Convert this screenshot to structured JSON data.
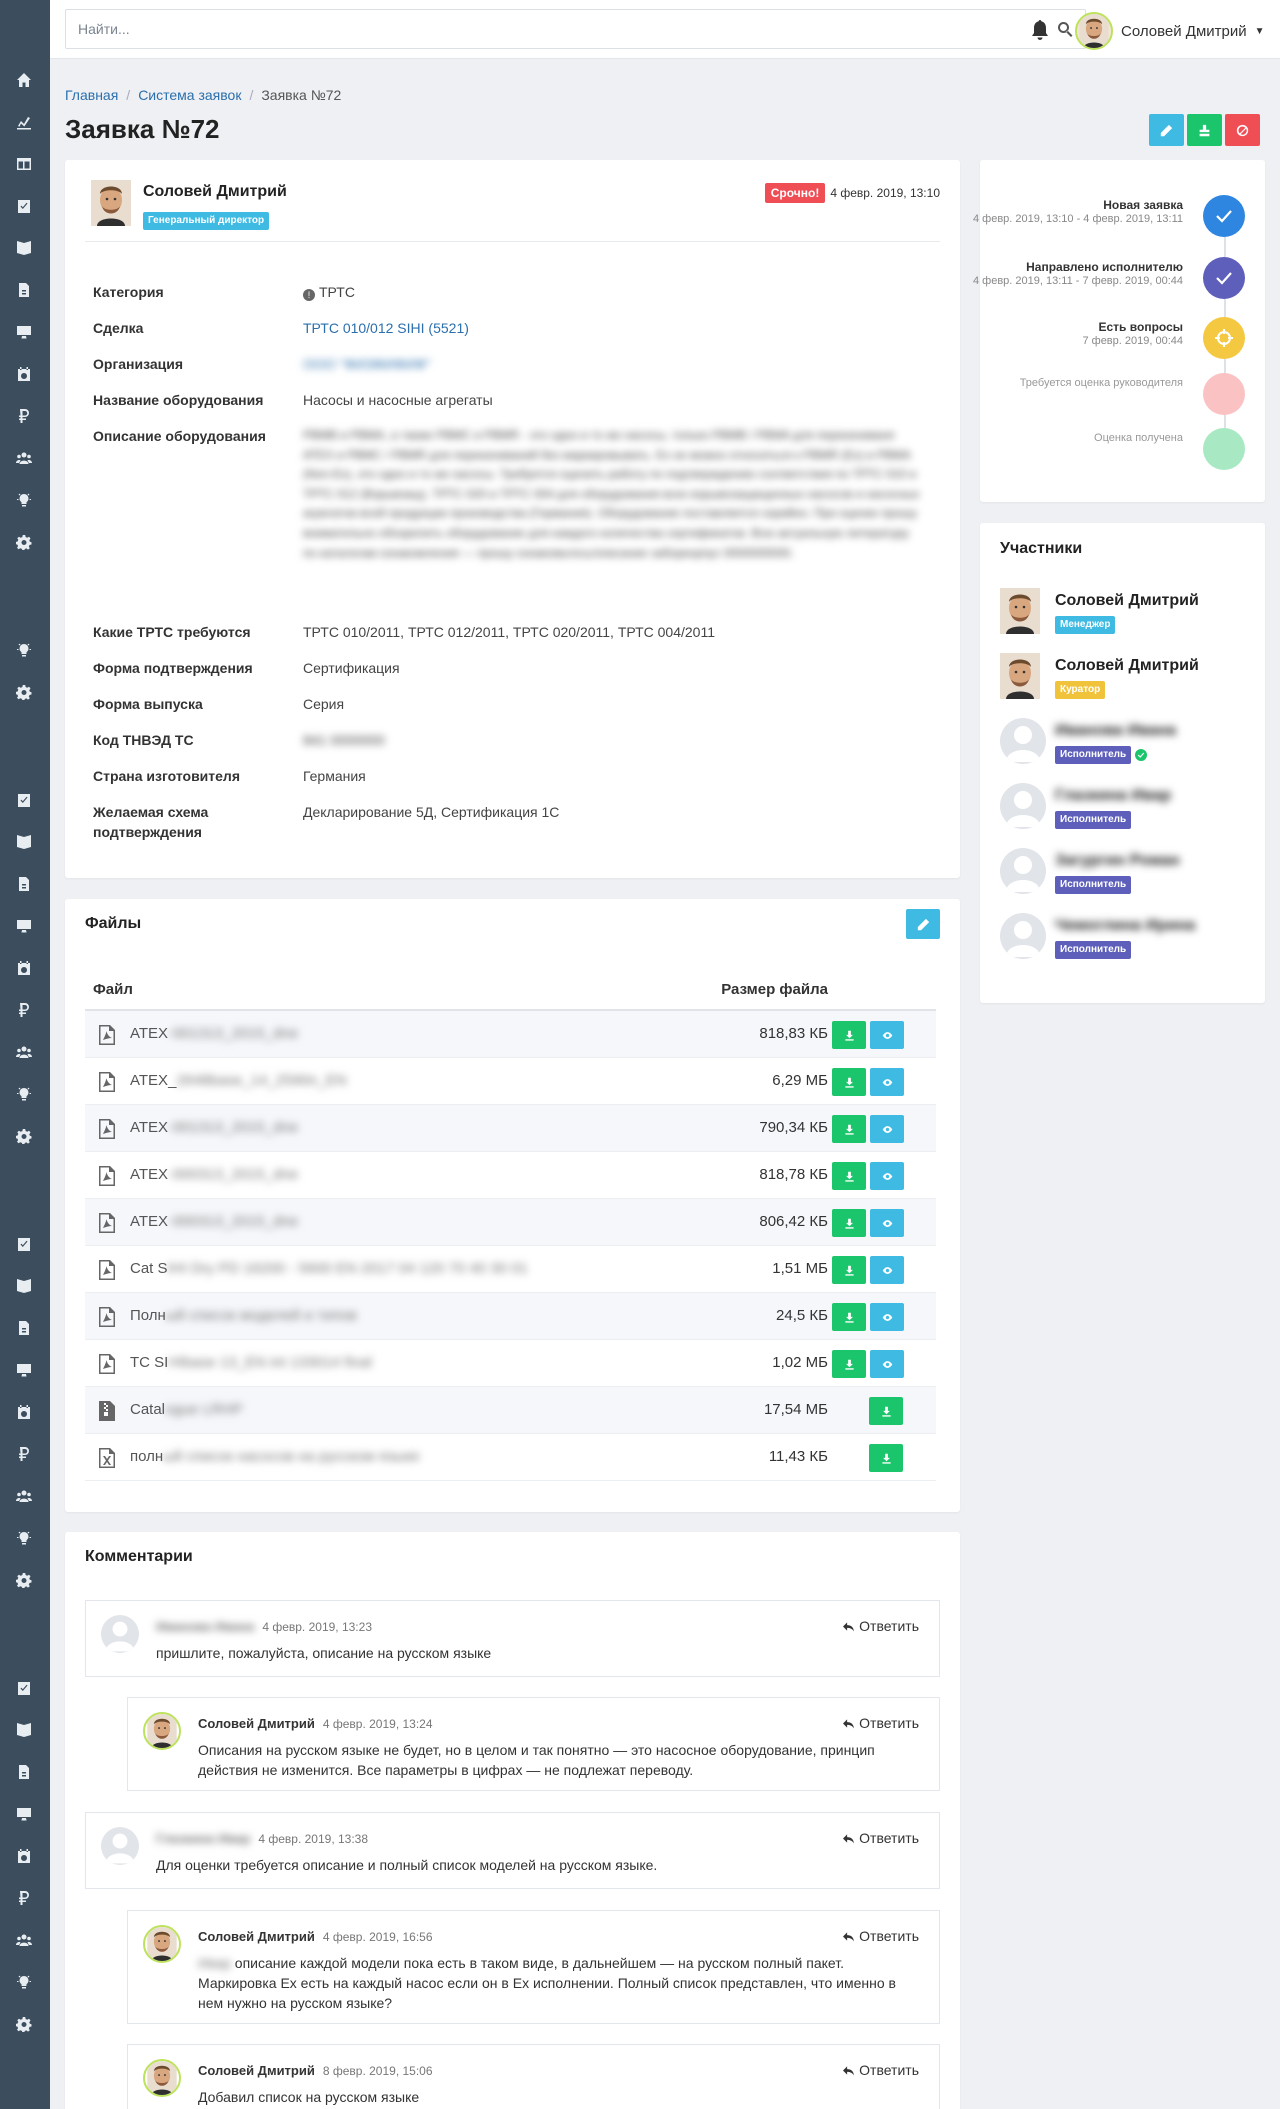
{
  "colors": {
    "sidebar": "#3c4e5e",
    "accent_blue": "#3ebae3",
    "green": "#1bc56b",
    "red": "#f04e55",
    "indigo": "#5d5fbb",
    "link": "#2b6fad"
  },
  "header": {
    "search_placeholder": "Найти...",
    "user_name": "Соловей Дмитрий"
  },
  "breadcrumb": [
    "Главная",
    "Система заявок",
    "Заявка №72"
  ],
  "page_title": "Заявка №72",
  "request": {
    "author": "Соловей Дмитрий",
    "role": "Генеральный директор",
    "priority": "Срочно!",
    "date": "4 февр. 2019, 13:10",
    "fields": [
      {
        "label": "Категория",
        "value": "ТРТС"
      },
      {
        "label": "Сделка",
        "value": "ТРТС 010/012 SIHI (5521)"
      },
      {
        "label": "Организация",
        "value": "ООО \"ФИЗФИФИФ\""
      },
      {
        "label": "Название оборудования",
        "value": "Насосы и насосные агрегаты"
      },
      {
        "label": "Описание оборудования",
        "value": "PBMB и PBMA, а также PBMC и PBMR - это одно и то же насосы, только PBMB / PBMA для перекачиваня ATEX и PBMC / PBMR для перекачиваний без маркировывать. Ex не можно относиться к PBMR (Ex) и PBMA (Non-Ex), это одно и то же насосы. Требуется оценить работу по подтверждению соответствия по ТРТС 010 и ТРТС 012 (Взрывзащ). ТРТС 020 и ТРТС 004 для оборудования всех взрывозащищенных насосов и насосных агрегатов всей продукции производства (Германия). Оборудование поставляется серийно. При оценке прошу внимательно обозрелить оборудование для каждого количества сертификатов. Всю актуальную литературу по каталогам ознакомления — прошу ознакомьтесь/описание заборкорпус 0000000000."
      },
      {
        "label": "Какие ТРТС требуются",
        "value": "ТРТС 010/2011, ТРТС 012/2011, ТРТС 020/2011, ТРТС 004/2011"
      },
      {
        "label": "Форма подтверждения",
        "value": "Сертификация"
      },
      {
        "label": "Форма выпуска",
        "value": "Серия"
      },
      {
        "label": "Код ТНВЭД ТС",
        "value": "841 0000000"
      },
      {
        "label": "Страна изготовителя",
        "value": "Германия"
      },
      {
        "label": "Желаемая схема подтверждения",
        "value": "Декларирование 5Д, Сертификация 1С"
      }
    ]
  },
  "files": {
    "title": "Файлы",
    "col_file": "Файл",
    "col_size": "Размер файла",
    "rows": [
      {
        "name_visible": "ATEX",
        "name_blurred": "-001313_2015_dne",
        "size": "818,83 КБ",
        "icon": "pdf-icon",
        "viewable": true
      },
      {
        "name_visible": "ATEX_",
        "name_blurred": "2648base_14_2590n_EN",
        "size": "6,29 МБ",
        "icon": "pdf-icon",
        "viewable": true
      },
      {
        "name_visible": "ATEX",
        "name_blurred": "-001313_2015_dne",
        "size": "790,34 КБ",
        "icon": "pdf-icon",
        "viewable": true
      },
      {
        "name_visible": "ATEX",
        "name_blurred": "-000313_2015_dne",
        "size": "818,78 КБ",
        "icon": "pdf-icon",
        "viewable": true
      },
      {
        "name_visible": "ATEX",
        "name_blurred": "-000313_2015_dne",
        "size": "806,42 КБ",
        "icon": "pdf-icon",
        "viewable": true
      },
      {
        "name_visible": "Cat S",
        "name_blurred": "IHI Dry PD 16200 - 5600 EN 2017 04 120 70 40 30 01",
        "size": "1,51 МБ",
        "icon": "pdf-icon",
        "viewable": true
      },
      {
        "name_visible": "Полн",
        "name_blurred": "ый список моделей и типов",
        "size": "24,5 КБ",
        "icon": "pdf-icon",
        "viewable": true
      },
      {
        "name_visible": "TC SI",
        "name_blurred": "HIbase 13_EN int 133014 final",
        "size": "1,02 МБ",
        "icon": "pdf-icon",
        "viewable": true
      },
      {
        "name_visible": "Catal",
        "name_blurred": "ogue LRHP",
        "size": "17,54 МБ",
        "icon": "archive-icon",
        "viewable": false
      },
      {
        "name_visible": "полн",
        "name_blurred": "ый список насосов на русском языке",
        "size": "11,43 КБ",
        "icon": "excel-icon",
        "viewable": false
      }
    ]
  },
  "comments": {
    "title": "Комментарии",
    "reply_label": "Ответить",
    "items": [
      {
        "author": "Иванова Ивана",
        "author_blurred": true,
        "date": "4 февр. 2019, 13:23",
        "text": "пришлите, пожалуйста, описание на русском языке",
        "indent": false,
        "has_photo": false
      },
      {
        "author": "Соловей Дмитрий",
        "author_blurred": false,
        "date": "4 февр. 2019, 13:24",
        "text": "Описания на русском языке не будет, но в целом и так понятно — это насосное оборудование, принцип действия не изменится. Все параметры в цифрах — не подлежат переводу.",
        "indent": true,
        "has_photo": true
      },
      {
        "author": "Глазкина Ивар",
        "author_blurred": true,
        "date": "4 февр. 2019, 13:38",
        "text": "Для оценки требуется описание и полный список моделей на русском языке.",
        "indent": false,
        "has_photo": false
      },
      {
        "author": "Соловей Дмитрий",
        "author_blurred": false,
        "date": "4 февр. 2019, 16:56",
        "text_blurred_prefix": "Ивар",
        "text": " описание каждой модели пока есть в таком виде, в дальнейшем — на русском полный пакет. Маркировка Ex есть на каждый насос если он в Ex исполнении. Полный список представлен, что именно в нем нужно на русском языке?",
        "indent": true,
        "has_photo": true
      },
      {
        "author": "Соловей Дмитрий",
        "author_blurred": false,
        "date": "8 февр. 2019, 15:06",
        "text": "Добавил список на русском языке",
        "indent": true,
        "has_photo": true
      }
    ]
  },
  "timeline": [
    {
      "title": "Новая заявка",
      "dates": "4 февр. 2019, 13:10 - 4 февр. 2019, 13:11",
      "status": "done",
      "color": "#2f86e0"
    },
    {
      "title": "Направлено исполнителю",
      "dates": "4 февр. 2019, 13:11 - 7 февр. 2019, 00:44",
      "status": "done",
      "color": "#5d5fbb"
    },
    {
      "title": "Есть вопросы",
      "dates": "7 февр. 2019, 00:44",
      "status": "current",
      "color": "#f5c842"
    },
    {
      "title": "Требуется оценка руководителя",
      "dates": "",
      "status": "pending",
      "color": "#fbc2c4"
    },
    {
      "title": "Оценка получена",
      "dates": "",
      "status": "pending",
      "color": "#a8e9c4"
    }
  ],
  "participants": {
    "title": "Участники",
    "items": [
      {
        "name": "Соловей Дмитрий",
        "role": "Менеджер",
        "role_color": "cyan",
        "blurred": false,
        "photo": true,
        "verified": false
      },
      {
        "name": "Соловей Дмитрий",
        "role": "Куратор",
        "role_color": "yellow",
        "blurred": false,
        "photo": true,
        "verified": false
      },
      {
        "name": "Иванова Ивана",
        "role": "Исполнитель",
        "role_color": "indigo",
        "blurred": true,
        "photo": false,
        "verified": true
      },
      {
        "name": "Глазкина Ивар",
        "role": "Исполнитель",
        "role_color": "indigo",
        "blurred": true,
        "photo": false,
        "verified": false
      },
      {
        "name": "Загургин Роман",
        "role": "Исполнитель",
        "role_color": "indigo",
        "blurred": true,
        "photo": false,
        "verified": false
      },
      {
        "name": "Чемоглина Ирина",
        "role": "Исполнитель",
        "role_color": "indigo",
        "blurred": true,
        "photo": false,
        "verified": false
      }
    ]
  }
}
